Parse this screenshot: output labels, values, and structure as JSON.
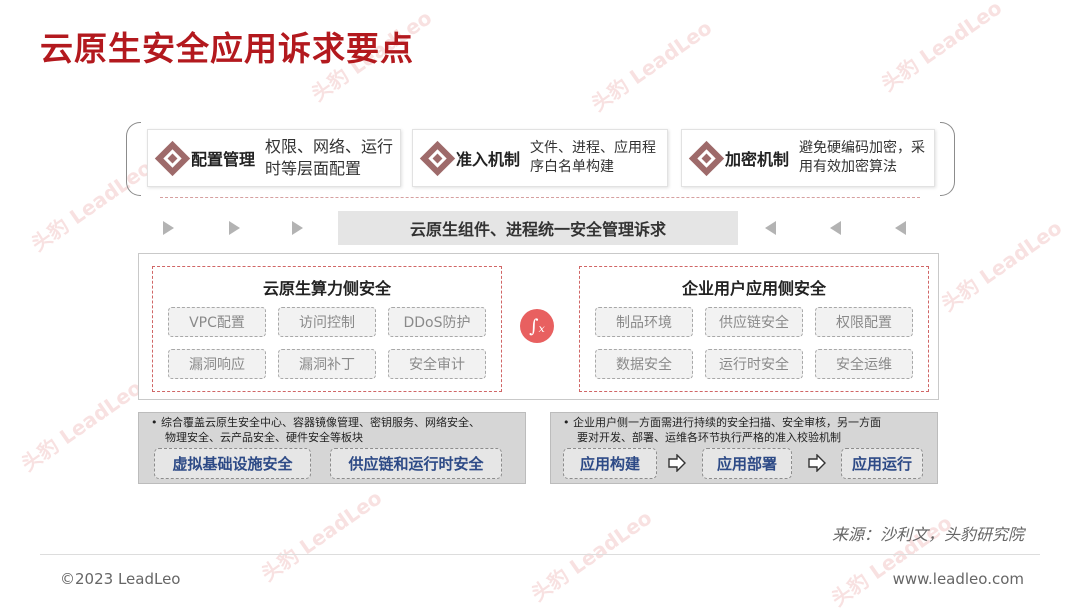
{
  "title": "云原生安全应用诉求要点",
  "colors": {
    "accent": "#b3191e",
    "tag_text": "#8a8a8a",
    "pill_text": "#2d4a86",
    "section_border": "#d06666"
  },
  "watermark": {
    "text": "头豹",
    "sub": "LeadLeo"
  },
  "cards": [
    {
      "title": "配置管理",
      "desc": "权限、网络、运行时等层面配置"
    },
    {
      "title": "准入机制",
      "desc": "文件、进程、应用程序白名单构建"
    },
    {
      "title": "加密机制",
      "desc": "避免硬编码加密，采用有效加密算法"
    }
  ],
  "banner": "云原生组件、进程统一安全管理诉求",
  "left_section": {
    "title": "云原生算力侧安全",
    "tags": [
      "VPC配置",
      "访问控制",
      "DDoS防护",
      "漏洞响应",
      "漏洞补丁",
      "安全审计"
    ]
  },
  "right_section": {
    "title": "企业用户应用侧安全",
    "tags": [
      "制品环境",
      "供应链安全",
      "权限配置",
      "数据安全",
      "运行时安全",
      "安全运维"
    ]
  },
  "center_icon": "function-icon",
  "left_panel": {
    "line1": "•  综合覆盖云原生安全中心、容器镜像管理、密钥服务、网络安全、",
    "line2": "物理安全、云产品安全、硬件安全等板块",
    "pills": [
      "虚拟基础设施安全",
      "供应链和运行时安全"
    ]
  },
  "right_panel": {
    "line1": "•  企业用户侧一方面需进行持续的安全扫描、安全审核，另一方面",
    "line2": "要对开发、部署、运维各环节执行严格的准入校验机制",
    "pills": [
      "应用构建",
      "应用部署",
      "应用运行"
    ]
  },
  "source": "来源：沙利文，头豹研究院",
  "footer": {
    "copyright": "©2023 LeadLeo",
    "site": "www.leadleo.com"
  }
}
